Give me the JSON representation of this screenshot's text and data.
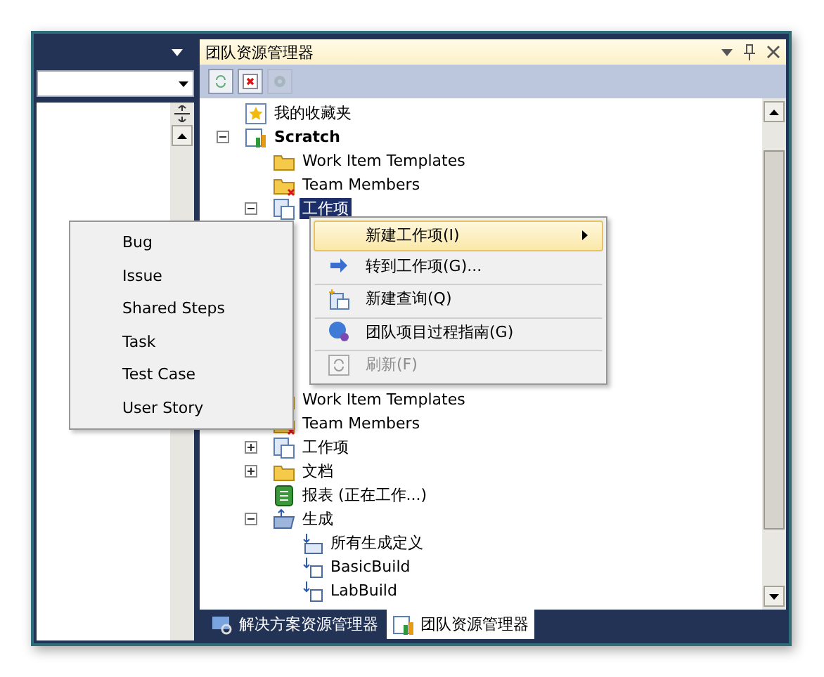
{
  "explorer": {
    "title": "团队资源管理器",
    "toolbar": [
      {
        "kind": "refresh",
        "disabled": false
      },
      {
        "kind": "delete",
        "disabled": false
      },
      {
        "kind": "settings",
        "disabled": true
      }
    ],
    "tree_top": [
      {
        "label": "我的收藏夹",
        "kind": "favorites",
        "selected": false
      },
      {
        "label": "Scratch",
        "kind": "project",
        "selected": false,
        "expanded": true,
        "children": [
          {
            "label": "Work Item Templates",
            "kind": "folder",
            "selected": false
          },
          {
            "label": "Team Members",
            "kind": "team-folder",
            "selected": false
          },
          {
            "label": "工作项",
            "kind": "work-items",
            "selected": true,
            "expanded": true
          }
        ]
      }
    ],
    "tree_bottom": [
      {
        "label": "Work Item Templates",
        "kind": "folder",
        "selected": false
      },
      {
        "label": "Team Members",
        "kind": "team-folder",
        "selected": false
      },
      {
        "label": "工作项",
        "kind": "work-items",
        "selected": false,
        "expanded": false
      },
      {
        "label": "文档",
        "kind": "folder",
        "selected": false,
        "expanded": false
      },
      {
        "label": "报表 (正在工作...)",
        "kind": "reports",
        "selected": false
      },
      {
        "label": "生成",
        "kind": "builds",
        "selected": false,
        "expanded": true,
        "children": [
          {
            "label": "所有生成定义",
            "kind": "build-all",
            "selected": false
          },
          {
            "label": "BasicBuild",
            "kind": "build-def",
            "selected": false
          },
          {
            "label": "LabBuild",
            "kind": "build-def",
            "selected": false
          }
        ]
      }
    ],
    "tabs": [
      {
        "label": "解决方案资源管理器",
        "kind": "solution",
        "selected": false
      },
      {
        "label": "团队资源管理器",
        "kind": "team",
        "selected": true
      }
    ]
  },
  "context_menu": [
    {
      "label": "新建工作项(I)",
      "kind": "submenu",
      "highlighted": true,
      "disabled": false,
      "divider_above": false
    },
    {
      "label": "转到工作项(G)...",
      "kind": "goto",
      "highlighted": false,
      "disabled": false,
      "divider_above": false
    },
    {
      "label": "新建查询(Q)",
      "kind": "query",
      "highlighted": false,
      "disabled": false,
      "divider_above": true
    },
    {
      "label": "团队项目过程指南(G)",
      "kind": "guide",
      "highlighted": false,
      "disabled": false,
      "divider_above": true
    },
    {
      "label": "刷新(F)",
      "kind": "refresh",
      "highlighted": false,
      "disabled": true,
      "divider_above": true
    }
  ],
  "submenu": [
    "Bug",
    "Issue",
    "Shared Steps",
    "Task",
    "Test Case",
    "User Story"
  ]
}
